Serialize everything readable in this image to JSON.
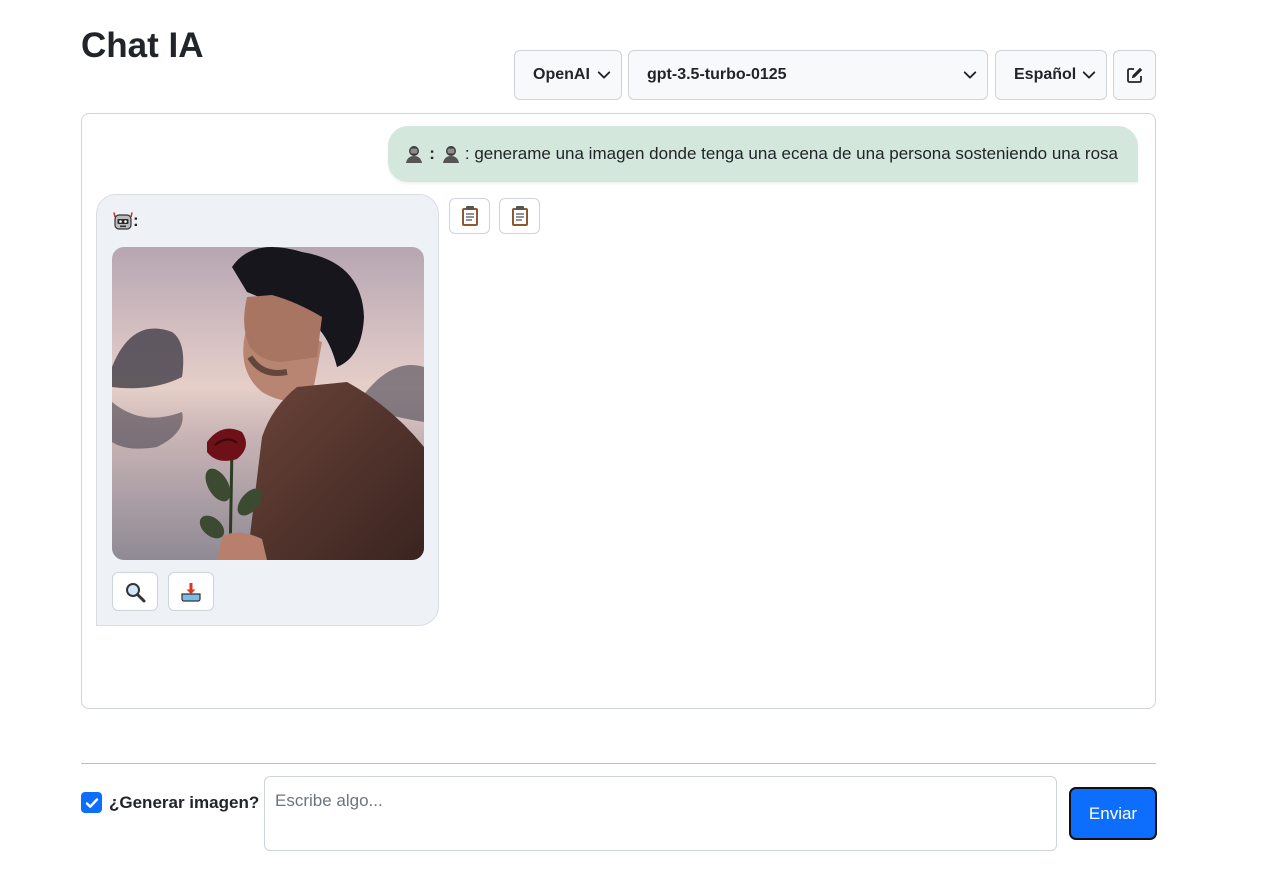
{
  "header": {
    "title": "Chat IA"
  },
  "controls": {
    "provider": "OpenAI",
    "model": "gpt-3.5-turbo-0125",
    "language": "Español",
    "edit_icon": "edit-icon"
  },
  "chat": {
    "user_message": {
      "avatar_icon": "person-icon",
      "text": ": generame una imagen donde tenga una ecena de una persona sosteniendo una rosa"
    },
    "bot_message": {
      "avatar_icon": "robot-icon",
      "label": ":",
      "image_subject": "man-holding-rose-image",
      "actions": [
        "zoom-icon",
        "download-icon"
      ]
    },
    "copy_actions": [
      "clipboard-icon",
      "clipboard-icon"
    ]
  },
  "footer": {
    "checkbox_label": "¿Generar imagen?",
    "checkbox_checked": true,
    "input_placeholder": "Escribe algo...",
    "send_label": "Enviar"
  },
  "colors": {
    "accent": "#0d6efd",
    "user_bubble": "#d4e7dd",
    "bot_bubble": "#eef1f5"
  }
}
